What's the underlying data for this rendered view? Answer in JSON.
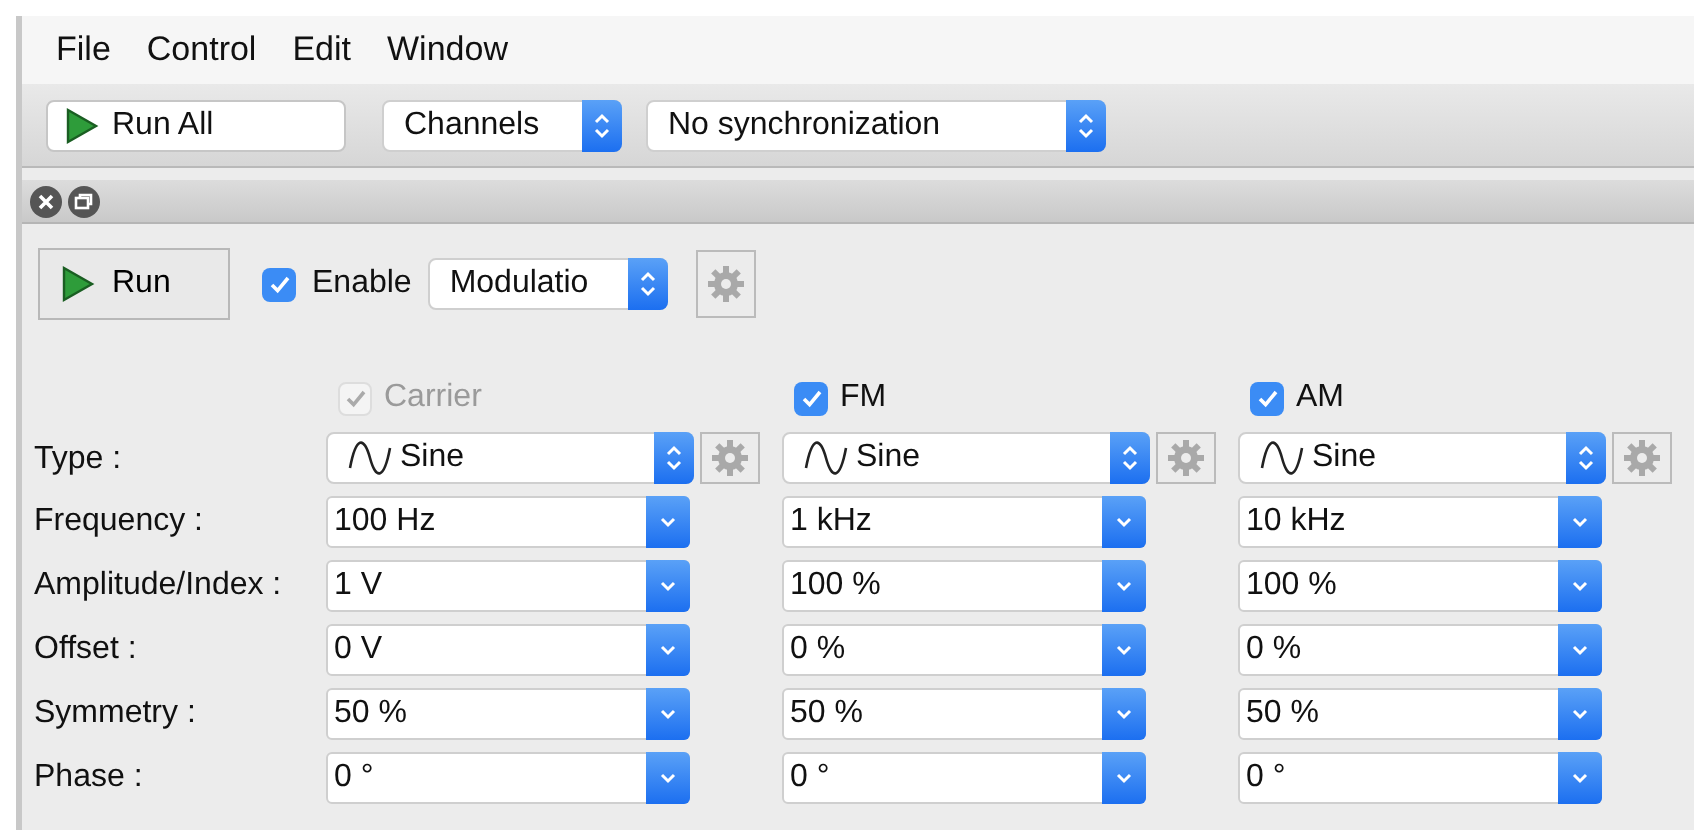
{
  "menu": [
    "File",
    "Control",
    "Edit",
    "Window"
  ],
  "toolbar": {
    "run_all": "Run All",
    "channels": "Channels",
    "sync": "No synchronization"
  },
  "panel": {
    "run": "Run",
    "enable": {
      "label": "Enable",
      "checked": true
    },
    "mode": "Modulatio"
  },
  "row_labels": [
    "Type :",
    "Frequency :",
    "Amplitude/Index :",
    "Offset :",
    "Symmetry :",
    "Phase :"
  ],
  "channels": [
    {
      "label": "Carrier",
      "checked": true,
      "disabled": true,
      "type": "Sine",
      "values": [
        "100 Hz",
        "1 V",
        "0 V",
        "50 %",
        "0 °"
      ]
    },
    {
      "label": "FM",
      "checked": true,
      "disabled": false,
      "type": "Sine",
      "values": [
        "1 kHz",
        "100 %",
        "0 %",
        "50 %",
        "0 °"
      ]
    },
    {
      "label": "AM",
      "checked": true,
      "disabled": false,
      "type": "Sine",
      "values": [
        "10 kHz",
        "100 %",
        "0 %",
        "50 %",
        "0 °"
      ]
    }
  ]
}
